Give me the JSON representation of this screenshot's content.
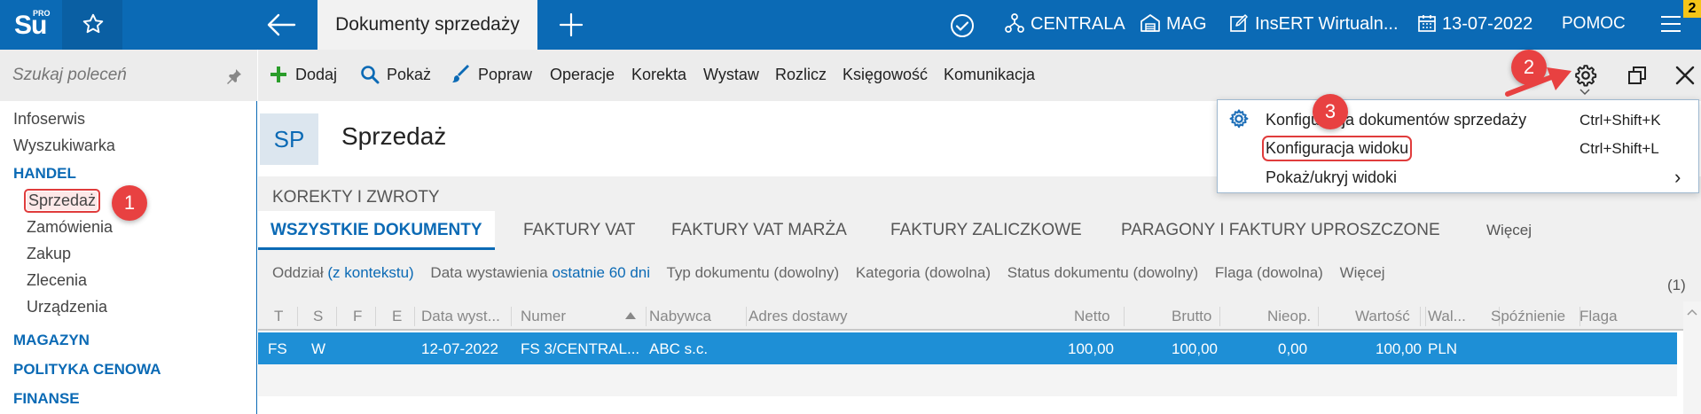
{
  "colors": {
    "brand": "#0b6ab5",
    "selection": "#1e8fd6",
    "marker": "#e84141",
    "badge": "#f5c518"
  },
  "topbar": {
    "logo": "Su",
    "logo_sup": "PRO",
    "document_tab": "Dokumenty sprzedaży",
    "branch": "CENTRALA",
    "warehouse": "MAG",
    "company": "InsERT Wirtualn...",
    "date": "13-07-2022",
    "help": "POMOC",
    "notification_count": "2"
  },
  "sidebar": {
    "search_placeholder": "Szukaj poleceń",
    "items": {
      "infoserwis": "Infoserwis",
      "wyszukiwarka": "Wyszukiwarka",
      "handel": "HANDEL",
      "sprzedaz": "Sprzedaż",
      "zamowienia": "Zamówienia",
      "zakup": "Zakup",
      "zlecenia": "Zlecenia",
      "urzadzenia": "Urządzenia",
      "magazyn": "MAGAZYN",
      "polityka": "POLITYKA CENOWA",
      "finanse": "FINANSE"
    }
  },
  "actions": {
    "dodaj": "Dodaj",
    "pokaz": "Pokaż",
    "popraw": "Popraw",
    "operacje": "Operacje",
    "korekta": "Korekta",
    "wystaw": "Wystaw",
    "rozlicz": "Rozlicz",
    "ksiegowosc": "Księgowość",
    "komunikacja": "Komunikacja"
  },
  "header": {
    "badge": "SP",
    "title": "Sprzedaż",
    "section": "KOREKTY I ZWROTY"
  },
  "tabs": {
    "all": "WSZYSTKIE DOKUMENTY",
    "vat": "FAKTURY VAT",
    "vat_marza": "FAKTURY VAT MARŻA",
    "zaliczkowe": "FAKTURY ZALICZKOWE",
    "paragony": "PARAGONY I FAKTURY UPROSZCZONE",
    "wiecej": "Więcej"
  },
  "filters": {
    "oddzial_label": "Oddział",
    "oddzial_value": "(z kontekstu)",
    "data_label": "Data wystawienia",
    "data_value": "ostatnie 60 dni",
    "typ": "Typ dokumentu (dowolny)",
    "kategoria": "Kategoria (dowolna)",
    "status": "Status dokumentu (dowolny)",
    "flaga": "Flaga (dowolna)",
    "wiecej": "Więcej"
  },
  "result_count": "(1)",
  "table": {
    "columns": {
      "t": "T",
      "s": "S",
      "f": "F",
      "e": "E",
      "data": "Data wyst...",
      "numer": "Numer",
      "nabywca": "Nabywca",
      "adres": "Adres dostawy",
      "netto": "Netto",
      "brutto": "Brutto",
      "nieop": "Nieop.",
      "wartosc": "Wartość",
      "waluta": "Wal...",
      "spoznienie": "Spóźnienie",
      "flaga": "Flaga"
    },
    "row": {
      "t": "FS",
      "s": "W",
      "data": "12-07-2022",
      "numer": "FS 3/CENTRAL...",
      "nabywca": "ABC s.c.",
      "netto": "100,00",
      "brutto": "100,00",
      "nieop": "0,00",
      "wartosc": "100,00",
      "waluta": "PLN"
    }
  },
  "menu": {
    "item1": "Konfiguracja dokumentów sprzedaży",
    "item1_shortcut": "Ctrl+Shift+K",
    "item2": "Konfiguracja widoku",
    "item2_shortcut": "Ctrl+Shift+L",
    "item3": "Pokaż/ukryj widoki",
    "item3_arrow": "›"
  },
  "steps": {
    "s1": "1",
    "s2": "2",
    "s3": "3"
  }
}
